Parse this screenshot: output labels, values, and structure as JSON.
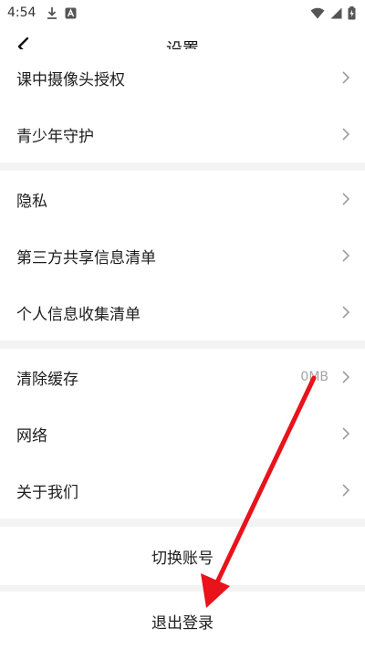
{
  "status_bar": {
    "time": "4:54",
    "left_icons": [
      "download-icon",
      "app-notification-icon"
    ],
    "right_icons": [
      "wifi-icon",
      "cellular-signal-icon",
      "battery-charging-icon"
    ]
  },
  "header": {
    "title": "设置",
    "back_icon": "chevron-left-icon"
  },
  "groups": [
    {
      "items": [
        {
          "label": "课中摄像头授权"
        },
        {
          "label": "青少年守护"
        }
      ]
    },
    {
      "items": [
        {
          "label": "隐私"
        },
        {
          "label": "第三方共享信息清单"
        },
        {
          "label": "个人信息收集清单"
        }
      ]
    },
    {
      "items": [
        {
          "label": "清除缓存",
          "value": "0MB"
        },
        {
          "label": "网络"
        },
        {
          "label": "关于我们"
        }
      ]
    }
  ],
  "switch_account_label": "切换账号",
  "logout_label": "退出登录",
  "annotation": {
    "type": "red-arrow",
    "color": "#e8131b"
  },
  "colors": {
    "background": "#f3f3f3",
    "surface": "#ffffff",
    "chevron": "#9e9e9e"
  }
}
